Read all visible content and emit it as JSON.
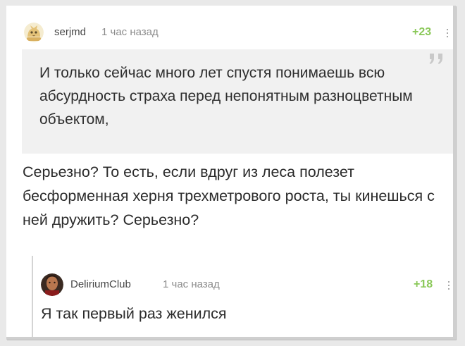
{
  "comment": {
    "author": "serjmd",
    "time": "1 час назад",
    "rating": "+23",
    "avatar_icon": "cat-avatar-icon",
    "quote": "И только сейчас много лет спустя понимаешь всю абсурдность страха перед непонятным разноцветным объектом,",
    "text": "Серьезно? То есть, если вдруг из леса полезет бесформенная херня трехметрового роста, ты кинешься с ней дружить? Серьезно?"
  },
  "reply": {
    "author": "DeliriumClub",
    "time": "1 час назад",
    "rating": "+18",
    "avatar_icon": "user-photo-avatar-icon",
    "text": "Я так первый раз женился"
  },
  "colors": {
    "rating_positive": "#8ac858",
    "quote_background": "#f1f1f1",
    "reply_thread_line": "#d4d4d4"
  }
}
